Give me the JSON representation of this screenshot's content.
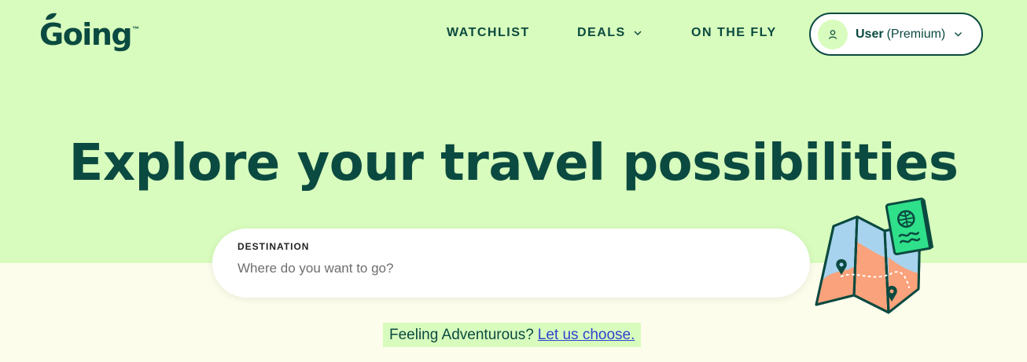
{
  "brand": {
    "logo_text": "Going",
    "trademark": "™",
    "primary_color": "#0b4a40",
    "hero_bg_color": "#d8fcbd",
    "page_bg_color": "#fdfdec",
    "link_color": "#2f42d0"
  },
  "nav": {
    "watchlist": "WATCHLIST",
    "deals": "DEALS",
    "on_the_fly": "ON THE FLY",
    "user": {
      "name": "User",
      "plan": "(Premium)",
      "avatar_icon": "user-icon"
    }
  },
  "hero": {
    "headline": "Explore your travel possibilities",
    "search": {
      "label": "DESTINATION",
      "value": "",
      "placeholder": "Where do you want to go?"
    },
    "illustration": "map-and-passport-illustration"
  },
  "feeling": {
    "text": "Feeling Adventurous?",
    "link": "Let us choose."
  }
}
